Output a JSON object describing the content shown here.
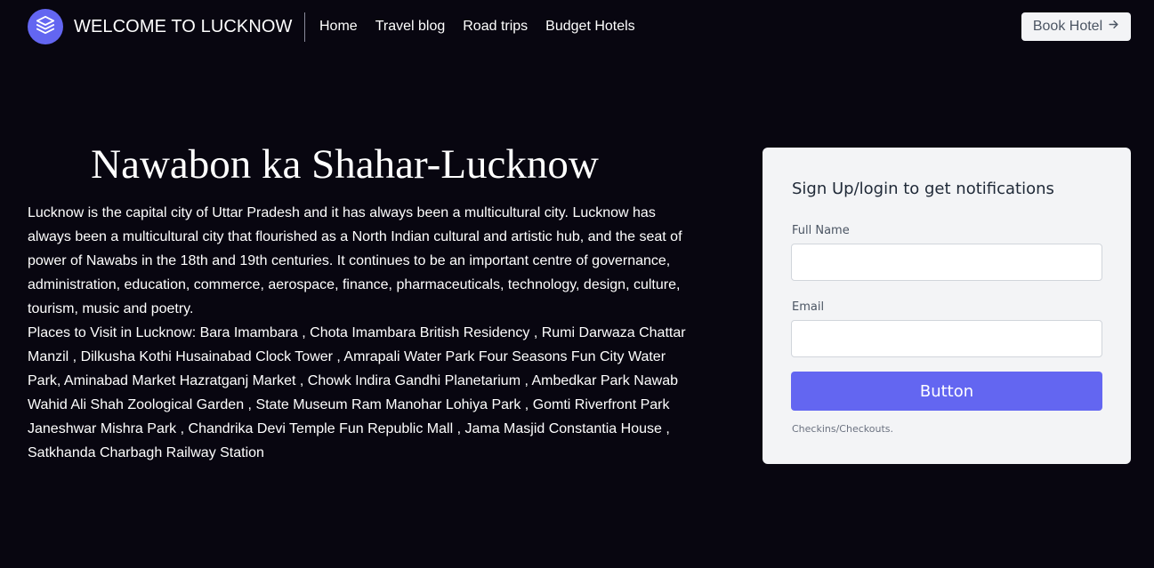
{
  "header": {
    "brand": "WELCOME TO LUCKNOW",
    "nav": [
      "Home",
      "Travel blog",
      "Road trips",
      "Budget Hotels"
    ],
    "book_button": "Book Hotel",
    "accent_color": "#6366f1"
  },
  "hero": {
    "title": "Nawabon ka Shahar-Lucknow",
    "paragraph1": "Lucknow is the capital city of Uttar Pradesh and it has always been a multicultural city. Lucknow has always been a multicultural city that flourished as a North Indian cultural and artistic hub, and the seat of power of Nawabs in the 18th and 19th centuries. It continues to be an important centre of governance, administration, education, commerce, aerospace, finance, pharmaceuticals, technology, design, culture, tourism, music and poetry.",
    "paragraph2": "Places to Visit in Lucknow: Bara Imambara , Chota Imambara British Residency , Rumi Darwaza Chattar Manzil , Dilkusha Kothi Husainabad Clock Tower , Amrapali Water Park Four Seasons Fun City Water Park, Aminabad Market Hazratganj Market , Chowk Indira Gandhi Planetarium , Ambedkar Park Nawab Wahid Ali Shah Zoological Garden , State Museum Ram Manohar Lohiya Park , Gomti Riverfront Park Janeshwar Mishra Park , Chandrika Devi Temple Fun Republic Mall , Jama Masjid Constantia House , Satkhanda Charbagh Railway Station"
  },
  "signup": {
    "title": "Sign Up/login to get notifications",
    "full_name_label": "Full Name",
    "full_name_value": "",
    "email_label": "Email",
    "email_value": "",
    "button": "Button",
    "note": "Checkins/Checkouts."
  }
}
